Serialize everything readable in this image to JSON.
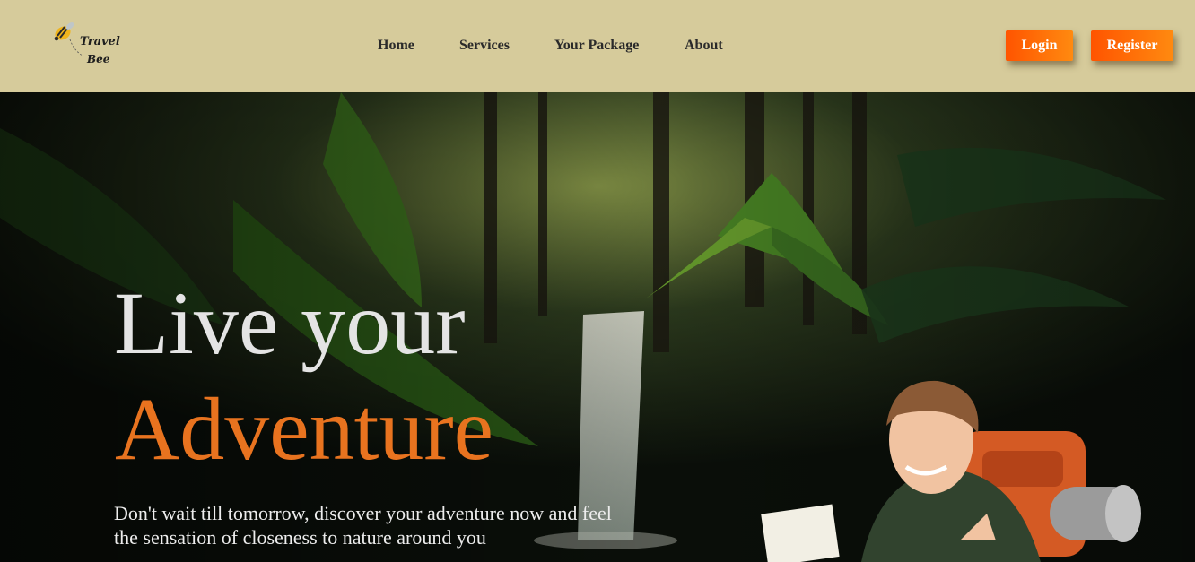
{
  "brand": {
    "logo_line_1": "Travel",
    "logo_line_2": "Bee"
  },
  "nav": {
    "items": [
      {
        "label": "Home"
      },
      {
        "label": "Services"
      },
      {
        "label": "Your Package"
      },
      {
        "label": "About"
      }
    ]
  },
  "auth": {
    "login_label": "Login",
    "register_label": "Register"
  },
  "hero": {
    "headline_line_1": "Live your",
    "headline_line_2": "Adventure",
    "description": "Don't wait till tomorrow, discover your adventure now and feel the sensation of closeness to nature around you"
  },
  "colors": {
    "navbar_bg": "#d6cb9b",
    "accent": "#e8731f",
    "button_gradient_start": "#ff5400",
    "button_gradient_end": "#ff8a10"
  },
  "icons": {
    "logo": "bee-icon"
  }
}
